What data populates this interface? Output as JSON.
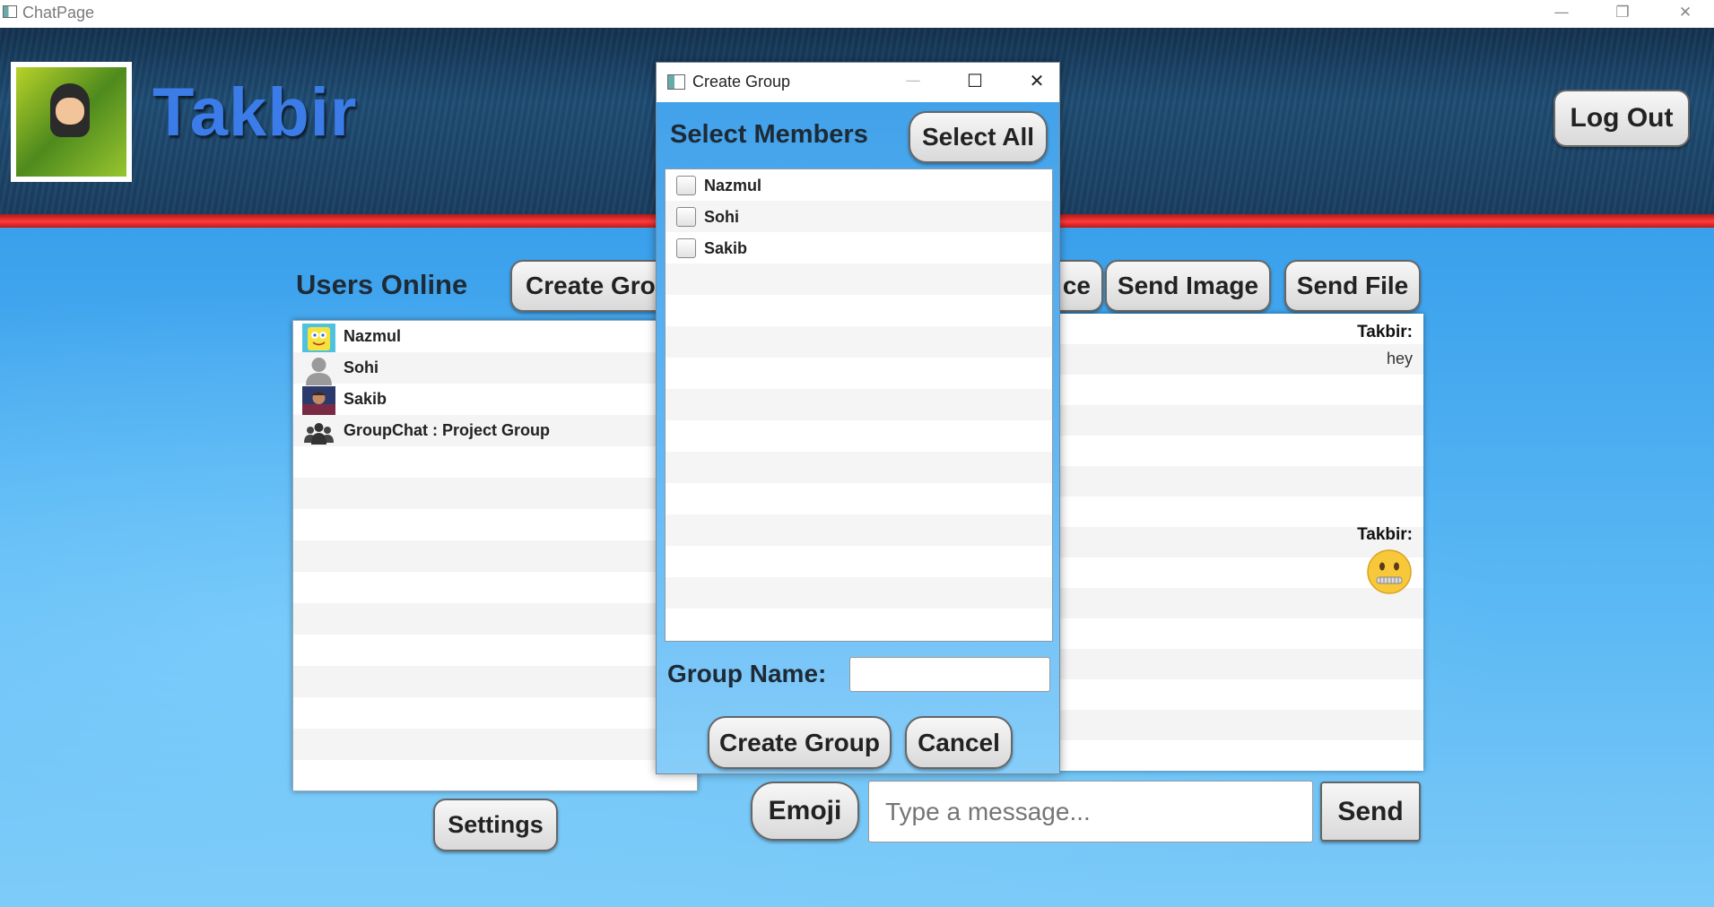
{
  "window": {
    "title": "ChatPage",
    "controls": [
      "—",
      "❐",
      "✕"
    ]
  },
  "header": {
    "username": "Takbir",
    "logout_label": "Log Out",
    "accent": "#3c7ce8"
  },
  "users_panel": {
    "title": "Users Online",
    "create_group_label": "Create Group",
    "users": [
      {
        "name": "Nazmul",
        "icon": "spongebob-avatar-icon"
      },
      {
        "name": "Sohi",
        "icon": "default-user-icon"
      },
      {
        "name": "Sakib",
        "icon": "photo-avatar-icon"
      },
      {
        "name": "GroupChat : Project Group",
        "icon": "group-icon"
      }
    ],
    "settings_label": "Settings"
  },
  "chat": {
    "partial_button_label": "ce",
    "send_image_label": "Send Image",
    "send_file_label": "Send File",
    "messages": [
      {
        "sender": "Takbir:",
        "text": "hey"
      },
      {
        "sender": "Takbir:",
        "emoji": "zipper-mouth-emoji"
      }
    ],
    "emoji_label": "Emoji",
    "message_placeholder": "Type a message...",
    "send_label": "Send"
  },
  "dialog": {
    "title": "Create Group",
    "controls": [
      "—",
      "☐",
      "✕"
    ],
    "select_members_label": "Select Members",
    "select_all_label": "Select All",
    "members": [
      {
        "name": "Nazmul",
        "checked": false
      },
      {
        "name": "Sohi",
        "checked": false
      },
      {
        "name": "Sakib",
        "checked": false
      }
    ],
    "group_name_label": "Group Name:",
    "group_name_value": "",
    "create_label": "Create Group",
    "cancel_label": "Cancel"
  }
}
